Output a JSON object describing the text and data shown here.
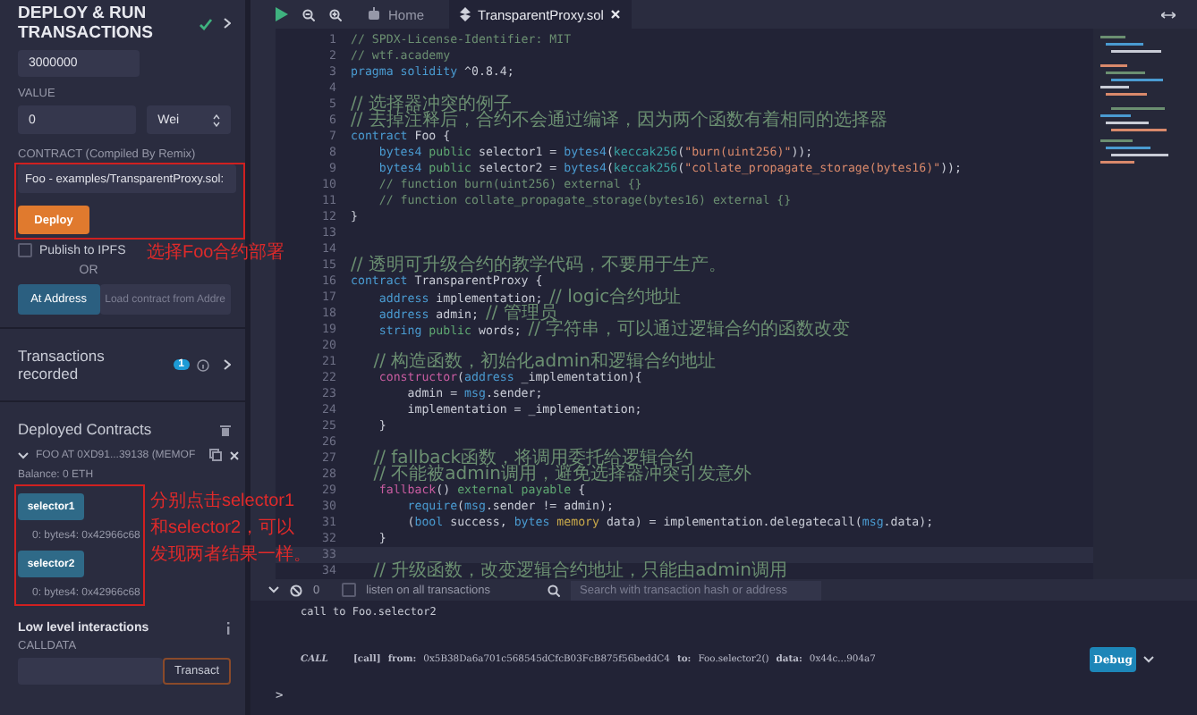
{
  "panel": {
    "title": "DEPLOY & RUN TRANSACTIONS",
    "gas_limit": "3000000",
    "value_label": "VALUE",
    "value": "0",
    "unit": "Wei",
    "contract_label": "CONTRACT (Compiled By Remix)",
    "contract": "Foo - examples/TransparentProxy.sol:",
    "deploy": "Deploy",
    "publish": {
      "label": "Publish to IPFS",
      "checked": false
    },
    "or": "OR",
    "at_address": "At Address",
    "address_placeholder": "Load contract from Addre",
    "transactions": {
      "label": "Transactions recorded",
      "count": "1"
    },
    "deployed_label": "Deployed Contracts",
    "instance": {
      "title": "FOO AT 0XD91...39138 (MEMOF",
      "expanded": true,
      "balance": "Balance: 0 ETH",
      "functions": [
        {
          "name": "selector1",
          "result": "0: bytes4: 0x42966c68"
        },
        {
          "name": "selector2",
          "result": "0: bytes4: 0x42966c68"
        }
      ]
    },
    "low_level": "Low level interactions",
    "calldata_label": "CALLDATA",
    "transact": "Transact"
  },
  "annotations": [
    {
      "lines": [
        "选择Foo合约部署"
      ]
    },
    {
      "lines": [
        "分别点击selector1",
        "和selector2，可以",
        "发现两者结果一样。"
      ]
    }
  ],
  "tabs": [
    {
      "label": "Home",
      "kind": "home",
      "selected": false
    },
    {
      "label": "TransparentProxy.sol",
      "kind": "file",
      "selected": true
    }
  ],
  "editor": {
    "lines": [
      {
        "number": "1",
        "highlighted": false,
        "tokens": [
          {
            "kind": "comment",
            "text": "// SPDX-License-Identifier: MIT"
          }
        ]
      },
      {
        "number": "2",
        "highlighted": false,
        "tokens": [
          {
            "kind": "comment",
            "text": "// wtf.academy"
          }
        ]
      },
      {
        "number": "3",
        "highlighted": false,
        "tokens": [
          {
            "kind": "keyword",
            "text": "pragma"
          },
          {
            "kind": "keyword",
            "text": " solidity"
          },
          {
            "kind": "plain",
            "text": " ^0.8.4;"
          }
        ]
      },
      {
        "number": "4",
        "highlighted": false
      },
      {
        "number": "5",
        "highlighted": false,
        "tokens": [
          {
            "kind": "comment_zh",
            "text": "// 选择器冲突的例子"
          }
        ]
      },
      {
        "number": "6",
        "highlighted": false,
        "tokens": [
          {
            "kind": "comment_zh",
            "text": "// 去掉注释后，合约不会通过编译，因为两个函数有着相同的选择器"
          }
        ]
      },
      {
        "number": "7",
        "highlighted": false,
        "tokens": [
          {
            "kind": "keyword",
            "text": "contract"
          },
          {
            "kind": "plain",
            "text": " Foo {"
          }
        ]
      },
      {
        "number": "8",
        "highlighted": false,
        "tokens": [
          {
            "kind": "keyword",
            "text": "    bytes4"
          },
          {
            "kind": "modifier",
            "text": " public"
          },
          {
            "kind": "plain",
            "text": " selector1 = "
          },
          {
            "kind": "keyword",
            "text": "bytes4"
          },
          {
            "kind": "plain",
            "text": "("
          },
          {
            "kind": "builtin",
            "text": "keccak256"
          },
          {
            "kind": "plain",
            "text": "("
          },
          {
            "kind": "string",
            "text": "\"burn(uint256)\""
          },
          {
            "kind": "plain",
            "text": "));"
          }
        ]
      },
      {
        "number": "9",
        "highlighted": false,
        "tokens": [
          {
            "kind": "keyword",
            "text": "    bytes4"
          },
          {
            "kind": "modifier",
            "text": " public"
          },
          {
            "kind": "plain",
            "text": " selector2 = "
          },
          {
            "kind": "keyword",
            "text": "bytes4"
          },
          {
            "kind": "plain",
            "text": "("
          },
          {
            "kind": "builtin",
            "text": "keccak256"
          },
          {
            "kind": "plain",
            "text": "("
          },
          {
            "kind": "string",
            "text": "\"collate_propagate_storage(bytes16)\""
          },
          {
            "kind": "plain",
            "text": "));"
          }
        ]
      },
      {
        "number": "10",
        "highlighted": false,
        "tokens": [
          {
            "kind": "comment",
            "text": "    // function burn(uint256) external {}"
          }
        ]
      },
      {
        "number": "11",
        "highlighted": false,
        "tokens": [
          {
            "kind": "comment",
            "text": "    // function collate_propagate_storage(bytes16) external {}"
          }
        ]
      },
      {
        "number": "12",
        "highlighted": false,
        "tokens": [
          {
            "kind": "plain",
            "text": "}"
          }
        ]
      },
      {
        "number": "13",
        "highlighted": false
      },
      {
        "number": "14",
        "highlighted": false
      },
      {
        "number": "15",
        "highlighted": false,
        "tokens": [
          {
            "kind": "comment_zh",
            "text": "// 透明可升级合约的教学代码，不要用于生产。"
          }
        ]
      },
      {
        "number": "16",
        "highlighted": false,
        "tokens": [
          {
            "kind": "keyword",
            "text": "contract"
          },
          {
            "kind": "plain",
            "text": " TransparentProxy {"
          }
        ]
      },
      {
        "number": "17",
        "highlighted": false,
        "tokens": [
          {
            "kind": "keyword",
            "text": "    address"
          },
          {
            "kind": "plain",
            "text": " implementation; "
          },
          {
            "kind": "comment_zh",
            "text": "// logic合约地址"
          }
        ]
      },
      {
        "number": "18",
        "highlighted": false,
        "tokens": [
          {
            "kind": "keyword",
            "text": "    address"
          },
          {
            "kind": "plain",
            "text": " admin; "
          },
          {
            "kind": "comment_zh",
            "text": "// 管理员"
          }
        ]
      },
      {
        "number": "19",
        "highlighted": false,
        "tokens": [
          {
            "kind": "keyword",
            "text": "    string"
          },
          {
            "kind": "modifier",
            "text": " public"
          },
          {
            "kind": "plain",
            "text": " words; "
          },
          {
            "kind": "comment_zh",
            "text": "// 字符串，可以通过逻辑合约的函数改变"
          }
        ]
      },
      {
        "number": "20",
        "highlighted": false
      },
      {
        "number": "21",
        "highlighted": false,
        "tokens": [
          {
            "kind": "comment_zh",
            "text": "    // 构造函数，初始化admin和逻辑合约地址"
          }
        ]
      },
      {
        "number": "22",
        "highlighted": false,
        "tokens": [
          {
            "kind": "special",
            "text": "    constructor"
          },
          {
            "kind": "plain",
            "text": "("
          },
          {
            "kind": "keyword",
            "text": "address"
          },
          {
            "kind": "plain",
            "text": " _implementation){"
          }
        ]
      },
      {
        "number": "23",
        "highlighted": false,
        "tokens": [
          {
            "kind": "plain",
            "text": "        admin = "
          },
          {
            "kind": "keyword",
            "text": "msg"
          },
          {
            "kind": "plain",
            "text": ".sender;"
          }
        ]
      },
      {
        "number": "24",
        "highlighted": false,
        "tokens": [
          {
            "kind": "plain",
            "text": "        implementation = _implementation;"
          }
        ]
      },
      {
        "number": "25",
        "highlighted": false,
        "tokens": [
          {
            "kind": "plain",
            "text": "    }"
          }
        ]
      },
      {
        "number": "26",
        "highlighted": false
      },
      {
        "number": "27",
        "highlighted": false,
        "tokens": [
          {
            "kind": "comment_zh",
            "text": "    // fallback函数，将调用委托给逻辑合约"
          }
        ]
      },
      {
        "number": "28",
        "highlighted": false,
        "tokens": [
          {
            "kind": "comment_zh",
            "text": "    // 不能被admin调用，避免选择器冲突引发意外"
          }
        ]
      },
      {
        "number": "29",
        "highlighted": false,
        "tokens": [
          {
            "kind": "special",
            "text": "    fallback"
          },
          {
            "kind": "plain",
            "text": "() "
          },
          {
            "kind": "modifier",
            "text": "external"
          },
          {
            "kind": "modifier",
            "text": " payable"
          },
          {
            "kind": "plain",
            "text": " {"
          }
        ]
      },
      {
        "number": "30",
        "highlighted": false,
        "tokens": [
          {
            "kind": "keyword",
            "text": "        require"
          },
          {
            "kind": "plain",
            "text": "("
          },
          {
            "kind": "keyword",
            "text": "msg"
          },
          {
            "kind": "plain",
            "text": ".sender != admin);"
          }
        ]
      },
      {
        "number": "31",
        "highlighted": false,
        "tokens": [
          {
            "kind": "plain",
            "text": "        ("
          },
          {
            "kind": "keyword",
            "text": "bool"
          },
          {
            "kind": "plain",
            "text": " success, "
          },
          {
            "kind": "keyword",
            "text": "bytes"
          },
          {
            "kind": "storage",
            "text": " memory"
          },
          {
            "kind": "plain",
            "text": " data) = implementation.delegatecall("
          },
          {
            "kind": "keyword",
            "text": "msg"
          },
          {
            "kind": "plain",
            "text": ".data);"
          }
        ]
      },
      {
        "number": "32",
        "highlighted": false,
        "tokens": [
          {
            "kind": "plain",
            "text": "    }"
          }
        ]
      },
      {
        "number": "33",
        "highlighted": true
      },
      {
        "number": "34",
        "highlighted": false,
        "tokens": [
          {
            "kind": "comment_zh",
            "text": "    // 升级函数，改变逻辑合约地址，只能由admin调用"
          }
        ]
      }
    ]
  },
  "terminal": {
    "pending": "0",
    "listen": {
      "label": "listen on all transactions",
      "checked": false
    },
    "search_placeholder": "Search with transaction hash or address",
    "log": "call to Foo.selector2",
    "tx": {
      "type": "CALL",
      "tag": "[call]",
      "from_label": "from:",
      "from": "0x5B38Da6a701c568545dCfcB03FcB875f56beddC4",
      "to_label": "to:",
      "to": "Foo.selector2()",
      "data_label": "data:",
      "data": "0x44c...904a7"
    },
    "debug": "Debug",
    "prompt": ">"
  }
}
